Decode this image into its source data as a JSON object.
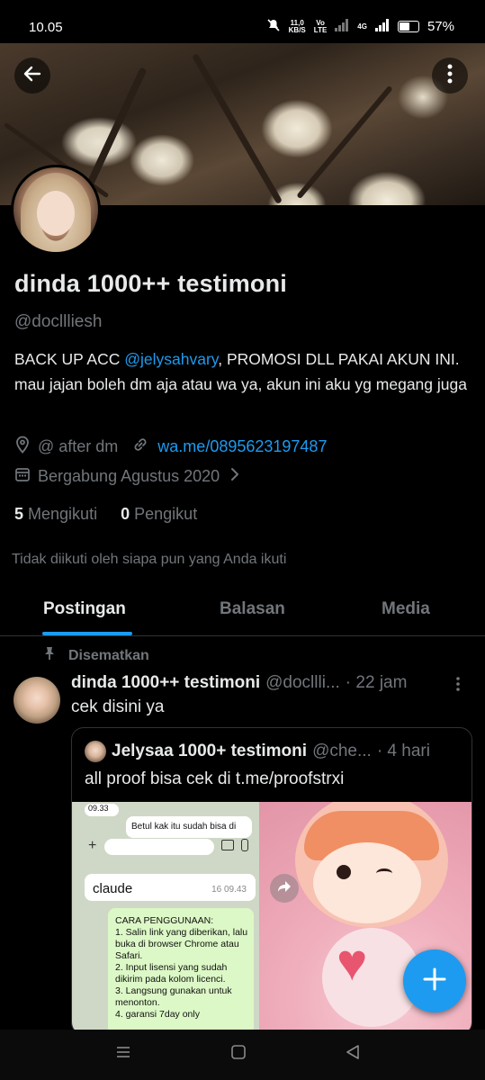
{
  "status_bar": {
    "time": "10.05",
    "net_speed": "11,0",
    "net_unit": "KB/S",
    "volte": "Vo",
    "lte": "LTE",
    "network": "4G",
    "battery": "57%"
  },
  "profile": {
    "display_name": "dinda 1000++ testimoni",
    "handle": "@docllliesh",
    "bio_prefix": "BACK UP ACC ",
    "bio_mention": "@jelysahvary",
    "bio_suffix": ", PROMOSI DLL PAKAI AKUN INI. mau jajan boleh dm aja atau wa ya, akun ini aku yg megang juga",
    "location": "@ after dm",
    "website": "wa.me/0895623197487",
    "joined": "Bergabung Agustus 2020",
    "following_count": "5",
    "following_label": "Mengikuti",
    "followers_count": "0",
    "followers_label": "Pengikut",
    "not_followed_text": "Tidak diikuti oleh siapa pun yang Anda ikuti"
  },
  "tabs": [
    {
      "label": "Postingan"
    },
    {
      "label": "Balasan"
    },
    {
      "label": "Media"
    }
  ],
  "pinned_post": {
    "pinned_label": "Disematkan",
    "author_name": "dinda 1000++ testimoni",
    "author_handle": "@docllli...",
    "time": "· 22 jam",
    "text": "cek disini ya",
    "quote": {
      "author_name": "Jelysaa 1000+ testimoni",
      "author_handle": "@che...",
      "time": "· 4 hari",
      "text": "all proof bisa cek di t.me/proofstrxi",
      "chat_time_top": "09.33",
      "chat_line": "Betul kak itu sudah bisa di",
      "chat_claude": "claude",
      "chat_views_time": "16 09.43",
      "chat_heading": "CARA PENGGUNAAN:",
      "chat_steps": [
        "1. Salin link yang diberikan, lalu buka di browser Chrome atau Safari.",
        "2. Input lisensi yang sudah dikirim pada kolom licenci.",
        "3. Langsung gunakan untuk menonton.",
        "4. garansi 7day only"
      ]
    }
  },
  "colors": {
    "accent": "#1d9bf0",
    "background": "#000000",
    "text_primary": "#e7e9ea",
    "text_secondary": "#71767b"
  },
  "icons": [
    "back-arrow-icon",
    "more-vertical-icon",
    "location-icon",
    "link-icon",
    "calendar-icon",
    "chevron-right-icon",
    "pin-icon",
    "plus-icon",
    "menu-icon",
    "home-square-icon",
    "back-triangle-icon"
  ]
}
